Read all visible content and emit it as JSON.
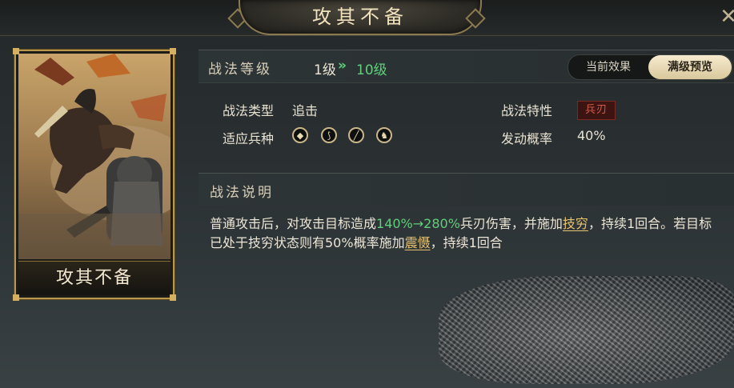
{
  "header": {
    "title": "攻其不备"
  },
  "card": {
    "name": "攻其不备"
  },
  "level": {
    "label": "战法等级",
    "current": "1级",
    "arrow": "»",
    "max": "10级"
  },
  "toggle": {
    "current_effect": "当前效果",
    "max_preview": "满级预览"
  },
  "attributes": {
    "type_label": "战法类型",
    "type_value": "追击",
    "trait_label": "战法特性",
    "trait_value": "兵刃",
    "units_label": "适应兵种",
    "units": [
      "shield-icon",
      "bow-icon",
      "spear-icon",
      "horse-icon"
    ],
    "rate_label": "发动概率",
    "rate_value": "40%"
  },
  "description": {
    "label": "战法说明",
    "part1": "普通攻击后，对攻击目标造成",
    "damage": "140%→280%",
    "part2": "兵刃伤害，并施加",
    "status1": "技穷",
    "part3": "，持续1回合。若目标已处于技穷状态则有50%概率施加",
    "status2": "震慑",
    "part4": "，持续1回合"
  },
  "colors": {
    "gold": "#b9984c",
    "green": "#5ed07a",
    "red_tag": "#d45a4c"
  }
}
